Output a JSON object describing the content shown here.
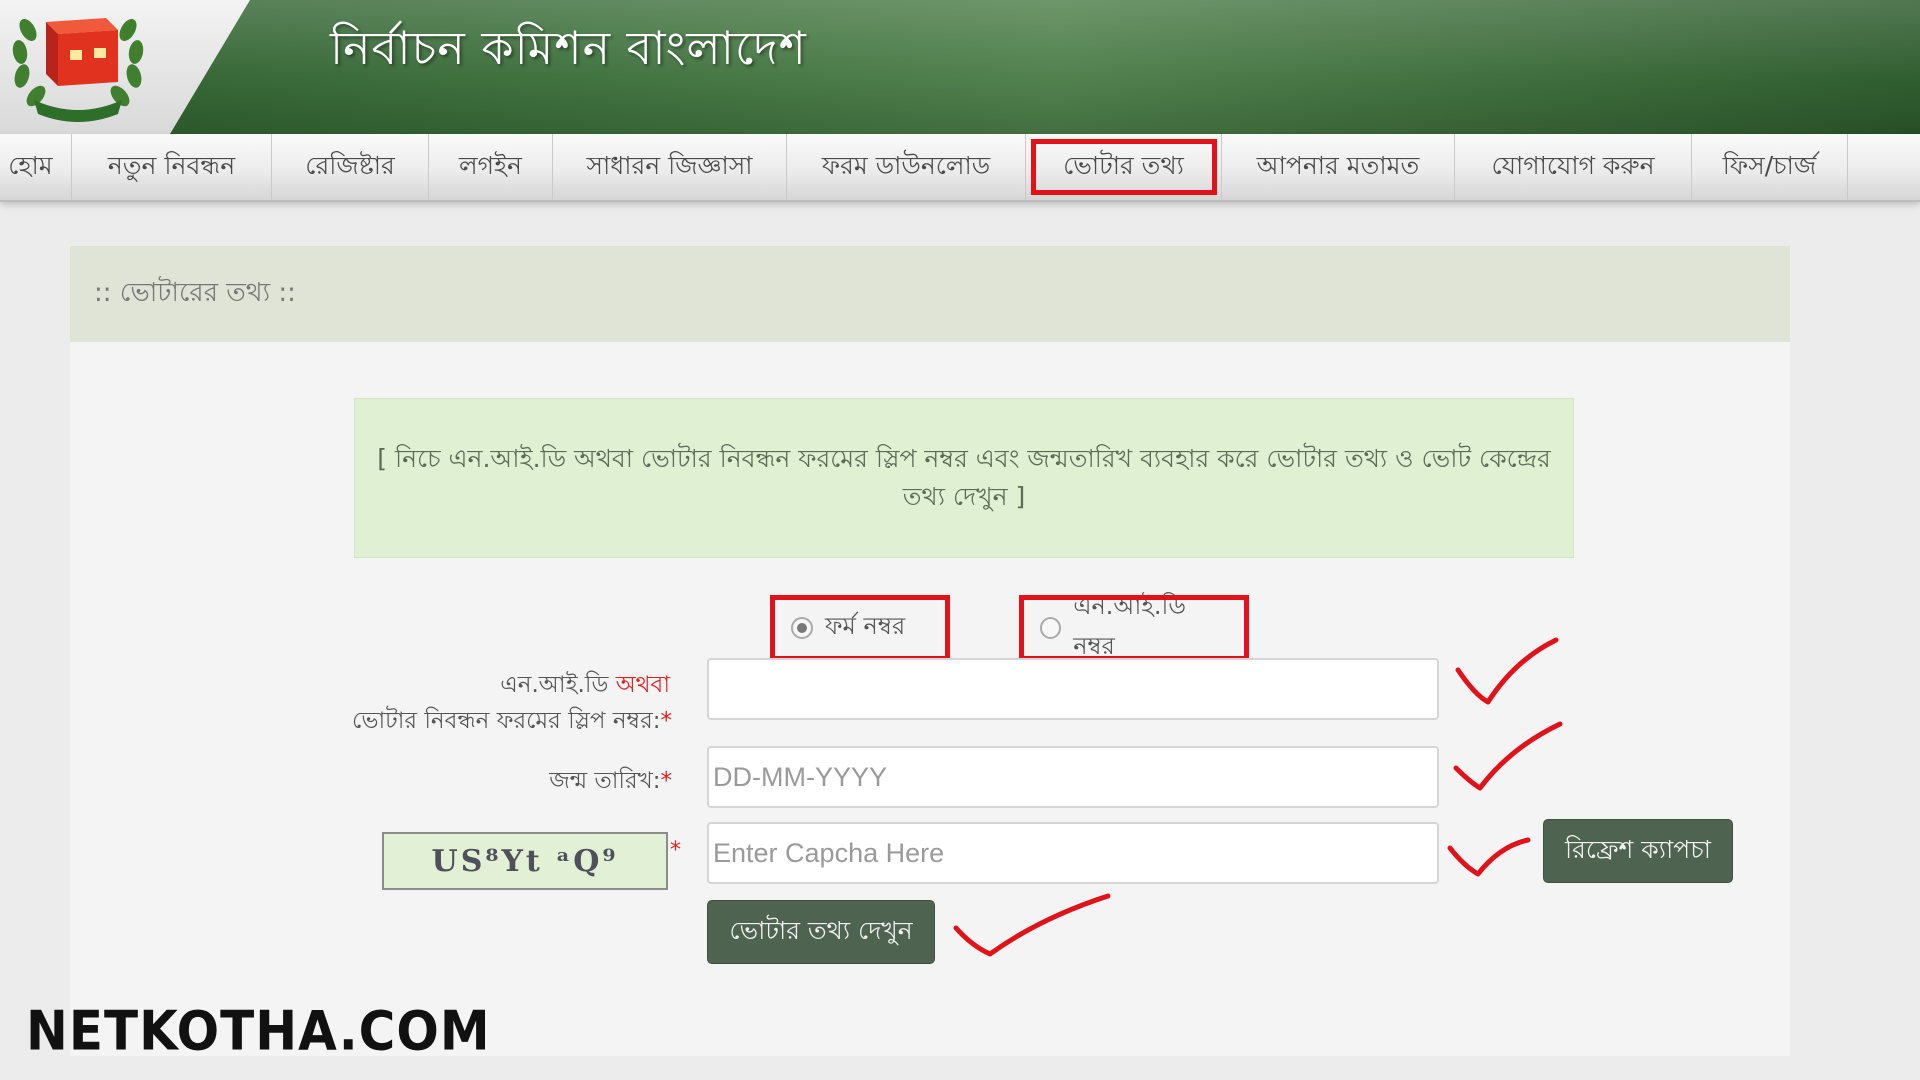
{
  "header": {
    "title": "নির্বাচন কমিশন বাংলাদেশ",
    "emblem_text": "বাংলাদেশ"
  },
  "nav": {
    "items": [
      {
        "label": "হোম"
      },
      {
        "label": "নতুন নিবন্ধন"
      },
      {
        "label": "রেজিষ্টার"
      },
      {
        "label": "লগইন"
      },
      {
        "label": "সাধারন জিজ্ঞাসা"
      },
      {
        "label": "ফরম ডাউনলোড"
      },
      {
        "label": "ভোটার তথ্য"
      },
      {
        "label": "আপনার মতামত"
      },
      {
        "label": "যোগাযোগ করুন"
      },
      {
        "label": "ফিস/চার্জ"
      }
    ],
    "highlighted": "ভোটার তথ্য"
  },
  "section": {
    "title": ":: ভোটারের তথ্য ::"
  },
  "info": {
    "text": "[ নিচে এন.আই.ডি অথবা ভোটার নিবন্ধন ফরমের স্লিপ নম্বর এবং জন্মতারিখ ব্যবহার করে ভোটার তথ্য ও ভোট কেন্দ্রের তথ্য দেখুন ]"
  },
  "form": {
    "radio_form": {
      "label": "ফর্ম নম্বর",
      "selected": true
    },
    "radio_nid": {
      "label": "এন.আই.ডি নম্বর",
      "selected": false
    },
    "nid_label_1": "এন.আই.ডি",
    "nid_label_or": "অথবা",
    "nid_label_2": "ভোটার নিবন্ধন ফরমের স্লিপ নম্বর:",
    "nid_value": "",
    "dob_label": "জন্ম তারিখ:",
    "dob_placeholder": "DD-MM-YYYY",
    "captcha_text": "US⁸Yt ᵃQ⁹",
    "captcha_placeholder": "Enter Capcha Here",
    "refresh_label": "রিফ্রেশ ক্যাপচা",
    "submit_label": "ভোটার তথ্য দেখুন",
    "required_mark": "*"
  },
  "accent_colors": {
    "highlight_red": "#e0131a",
    "header_green": "#3d703c",
    "button_green": "#4f6450"
  },
  "watermark": "NETKOTHA.COM"
}
